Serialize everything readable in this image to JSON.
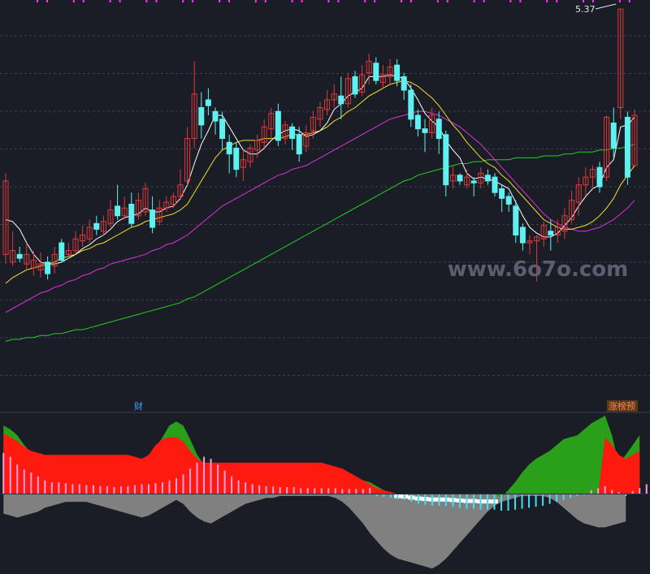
{
  "colors": {
    "background": "#1b1d26",
    "grid": "#3a3e52",
    "up_candle": "#e0393a",
    "down_candle": "#5ff0f0",
    "ma5": "#ffffff",
    "ma10": "#f0e020",
    "ma20": "#e030e0",
    "ma60": "#20d020",
    "ind_green": "#2aa01a",
    "ind_red": "#ff1a10",
    "ind_white": "#ffffff",
    "ind_gray": "#808080",
    "ind_dark": "#404040",
    "bar_pink": "#f5a0e0",
    "bar_cyan": "#40e0f0",
    "marker": "#ff30ff"
  },
  "annotations": {
    "high_price": "5.37",
    "watermark": "www.6o7o.com",
    "label_left": "财",
    "label_right": "涨榜预"
  },
  "chart_data": [
    {
      "type": "candlestick",
      "panel": "main",
      "ohlc": [
        [
          4.1,
          4.48,
          4.05,
          4.52
        ],
        [
          4.06,
          4.12,
          4.04,
          4.22
        ],
        [
          4.1,
          4.08,
          4.06,
          4.14
        ],
        [
          4.05,
          4.1,
          4.02,
          4.16
        ],
        [
          4.03,
          4.07,
          3.99,
          4.12
        ],
        [
          4.02,
          4.05,
          3.98,
          4.11
        ],
        [
          4.06,
          4.0,
          3.97,
          4.09
        ],
        [
          4.04,
          4.1,
          4.0,
          4.14
        ],
        [
          4.16,
          4.07,
          4.06,
          4.18
        ],
        [
          4.1,
          4.12,
          4.08,
          4.16
        ],
        [
          4.12,
          4.18,
          4.1,
          4.22
        ],
        [
          4.17,
          4.2,
          4.14,
          4.25
        ],
        [
          4.18,
          4.24,
          4.16,
          4.28
        ],
        [
          4.26,
          4.23,
          4.2,
          4.3
        ],
        [
          4.22,
          4.27,
          4.2,
          4.3
        ],
        [
          4.26,
          4.33,
          4.24,
          4.38
        ],
        [
          4.35,
          4.3,
          4.28,
          4.46
        ],
        [
          4.3,
          4.34,
          4.28,
          4.4
        ],
        [
          4.36,
          4.26,
          4.24,
          4.42
        ],
        [
          4.3,
          4.38,
          4.28,
          4.42
        ],
        [
          4.32,
          4.44,
          4.3,
          4.47
        ],
        [
          4.33,
          4.24,
          4.21,
          4.4
        ],
        [
          4.27,
          4.34,
          4.25,
          4.38
        ],
        [
          4.34,
          4.37,
          4.32,
          4.4
        ],
        [
          4.36,
          4.4,
          4.34,
          4.42
        ],
        [
          4.4,
          4.46,
          4.38,
          4.54
        ],
        [
          4.48,
          4.7,
          4.46,
          4.76
        ],
        [
          4.7,
          4.93,
          4.65,
          5.1
        ],
        [
          4.86,
          4.77,
          4.7,
          4.94
        ],
        [
          4.9,
          4.87,
          4.82,
          4.96
        ],
        [
          4.84,
          4.79,
          4.72,
          4.86
        ],
        [
          4.8,
          4.7,
          4.64,
          4.84
        ],
        [
          4.68,
          4.62,
          4.52,
          4.72
        ],
        [
          4.65,
          4.54,
          4.5,
          4.68
        ],
        [
          4.55,
          4.59,
          4.48,
          4.64
        ],
        [
          4.58,
          4.65,
          4.55,
          4.67
        ],
        [
          4.64,
          4.69,
          4.6,
          4.72
        ],
        [
          4.68,
          4.76,
          4.65,
          4.8
        ],
        [
          4.75,
          4.83,
          4.7,
          4.86
        ],
        [
          4.84,
          4.69,
          4.66,
          4.88
        ],
        [
          4.7,
          4.77,
          4.67,
          4.79
        ],
        [
          4.76,
          4.7,
          4.64,
          4.78
        ],
        [
          4.72,
          4.62,
          4.58,
          4.76
        ],
        [
          4.66,
          4.73,
          4.63,
          4.77
        ],
        [
          4.74,
          4.81,
          4.7,
          4.84
        ],
        [
          4.8,
          4.86,
          4.76,
          4.89
        ],
        [
          4.85,
          4.9,
          4.82,
          4.95
        ],
        [
          4.9,
          4.93,
          4.86,
          4.98
        ],
        [
          4.92,
          4.88,
          4.8,
          5.02
        ],
        [
          4.88,
          5.01,
          4.86,
          5.04
        ],
        [
          5.02,
          4.93,
          4.91,
          5.05
        ],
        [
          4.94,
          5.03,
          4.92,
          5.08
        ],
        [
          5.04,
          5.1,
          4.98,
          5.14
        ],
        [
          5.09,
          5.0,
          4.98,
          5.12
        ],
        [
          4.99,
          5.03,
          4.96,
          5.08
        ],
        [
          5.02,
          5.07,
          4.98,
          5.11
        ],
        [
          5.08,
          5.0,
          4.97,
          5.11
        ],
        [
          5.02,
          4.95,
          4.9,
          5.04
        ],
        [
          4.95,
          4.8,
          4.76,
          4.98
        ],
        [
          4.82,
          4.75,
          4.71,
          4.85
        ],
        [
          4.75,
          4.73,
          4.63,
          4.8
        ],
        [
          4.73,
          4.82,
          4.7,
          4.86
        ],
        [
          4.8,
          4.7,
          4.62,
          4.84
        ],
        [
          4.72,
          4.46,
          4.4,
          4.74
        ],
        [
          4.48,
          4.51,
          4.44,
          4.56
        ],
        [
          4.51,
          4.48,
          4.46,
          4.52
        ],
        [
          4.46,
          4.5,
          4.44,
          4.54
        ],
        [
          4.48,
          4.47,
          4.4,
          4.5
        ],
        [
          4.47,
          4.52,
          4.44,
          4.55
        ],
        [
          4.51,
          4.48,
          4.46,
          4.54
        ],
        [
          4.5,
          4.42,
          4.4,
          4.52
        ],
        [
          4.44,
          4.39,
          4.32,
          4.46
        ],
        [
          4.4,
          4.36,
          4.32,
          4.42
        ],
        [
          4.35,
          4.2,
          4.16,
          4.38
        ],
        [
          4.24,
          4.16,
          4.12,
          4.26
        ],
        [
          4.16,
          4.17,
          4.1,
          4.2
        ],
        [
          4.17,
          4.19,
          3.96,
          4.2
        ],
        [
          4.18,
          4.25,
          4.14,
          4.27
        ],
        [
          4.22,
          4.2,
          4.12,
          4.28
        ],
        [
          4.2,
          4.24,
          4.16,
          4.28
        ],
        [
          4.22,
          4.3,
          4.18,
          4.34
        ],
        [
          4.28,
          4.38,
          4.26,
          4.43
        ],
        [
          4.37,
          4.46,
          4.3,
          4.5
        ],
        [
          4.46,
          4.5,
          4.4,
          4.55
        ],
        [
          4.5,
          4.54,
          4.44,
          4.56
        ],
        [
          4.55,
          4.45,
          4.42,
          4.58
        ],
        [
          4.5,
          4.81,
          4.48,
          4.82
        ],
        [
          4.78,
          4.65,
          4.6,
          4.86
        ],
        [
          4.86,
          5.37,
          4.8,
          5.37
        ],
        [
          4.81,
          4.5,
          4.46,
          4.84
        ],
        [
          4.56,
          4.82,
          4.55,
          4.85
        ]
      ],
      "ma5": [
        4.28,
        4.27,
        4.23,
        4.16,
        4.1,
        4.06,
        4.05,
        4.05,
        4.06,
        4.08,
        4.1,
        4.13,
        4.15,
        4.18,
        4.2,
        4.23,
        4.27,
        4.29,
        4.3,
        4.31,
        4.34,
        4.32,
        4.32,
        4.34,
        4.35,
        4.39,
        4.46,
        4.57,
        4.67,
        4.74,
        4.82,
        4.82,
        4.76,
        4.7,
        4.64,
        4.62,
        4.62,
        4.65,
        4.69,
        4.72,
        4.74,
        4.75,
        4.74,
        4.71,
        4.72,
        4.74,
        4.78,
        4.85,
        4.88,
        4.92,
        4.94,
        4.96,
        5.02,
        5.02,
        5.02,
        5.03,
        5.02,
        5.01,
        4.96,
        4.9,
        4.83,
        4.79,
        4.76,
        4.69,
        4.64,
        4.6,
        4.52,
        4.49,
        4.5,
        4.49,
        4.48,
        4.46,
        4.44,
        4.37,
        4.3,
        4.24,
        4.21,
        4.19,
        4.19,
        4.21,
        4.25,
        4.29,
        4.35,
        4.4,
        4.44,
        4.46,
        4.55,
        4.59,
        4.76,
        4.77,
        4.81
      ],
      "ma10": [
        3.95,
        3.98,
        4.0,
        4.02,
        4.03,
        4.04,
        4.05,
        4.06,
        4.08,
        4.09,
        4.1,
        4.12,
        4.13,
        4.15,
        4.16,
        4.18,
        4.2,
        4.22,
        4.24,
        4.25,
        4.27,
        4.28,
        4.29,
        4.3,
        4.31,
        4.33,
        4.36,
        4.42,
        4.48,
        4.54,
        4.6,
        4.64,
        4.66,
        4.68,
        4.69,
        4.69,
        4.69,
        4.7,
        4.7,
        4.7,
        4.71,
        4.72,
        4.72,
        4.72,
        4.73,
        4.74,
        4.76,
        4.79,
        4.81,
        4.84,
        4.86,
        4.89,
        4.92,
        4.94,
        4.96,
        4.98,
        4.99,
        5.0,
        4.99,
        4.97,
        4.94,
        4.91,
        4.87,
        4.82,
        4.77,
        4.73,
        4.68,
        4.64,
        4.6,
        4.57,
        4.55,
        4.51,
        4.48,
        4.44,
        4.4,
        4.36,
        4.32,
        4.28,
        4.26,
        4.24,
        4.23,
        4.23,
        4.24,
        4.25,
        4.27,
        4.3,
        4.34,
        4.39,
        4.46,
        4.51,
        4.56
      ],
      "ma20": [
        3.8,
        3.82,
        3.84,
        3.86,
        3.88,
        3.9,
        3.91,
        3.93,
        3.94,
        3.96,
        3.97,
        3.99,
        4.0,
        4.02,
        4.03,
        4.05,
        4.06,
        4.07,
        4.08,
        4.09,
        4.1,
        4.12,
        4.13,
        4.15,
        4.16,
        4.18,
        4.2,
        4.23,
        4.26,
        4.29,
        4.32,
        4.35,
        4.37,
        4.39,
        4.41,
        4.43,
        4.45,
        4.47,
        4.49,
        4.51,
        4.52,
        4.54,
        4.55,
        4.56,
        4.58,
        4.6,
        4.62,
        4.64,
        4.66,
        4.68,
        4.7,
        4.72,
        4.74,
        4.76,
        4.78,
        4.8,
        4.81,
        4.82,
        4.83,
        4.84,
        4.84,
        4.83,
        4.82,
        4.8,
        4.78,
        4.76,
        4.73,
        4.7,
        4.67,
        4.63,
        4.59,
        4.55,
        4.51,
        4.47,
        4.43,
        4.39,
        4.35,
        4.31,
        4.28,
        4.26,
        4.24,
        4.23,
        4.22,
        4.22,
        4.23,
        4.24,
        4.26,
        4.28,
        4.31,
        4.34,
        4.38
      ],
      "ma60": [
        3.65,
        3.66,
        3.66,
        3.67,
        3.67,
        3.68,
        3.68,
        3.69,
        3.69,
        3.7,
        3.71,
        3.71,
        3.72,
        3.73,
        3.74,
        3.75,
        3.76,
        3.77,
        3.78,
        3.79,
        3.8,
        3.81,
        3.82,
        3.83,
        3.84,
        3.85,
        3.87,
        3.88,
        3.9,
        3.92,
        3.94,
        3.96,
        3.98,
        4.0,
        4.02,
        4.04,
        4.06,
        4.08,
        4.1,
        4.12,
        4.14,
        4.16,
        4.18,
        4.2,
        4.22,
        4.24,
        4.26,
        4.28,
        4.3,
        4.32,
        4.34,
        4.36,
        4.38,
        4.4,
        4.42,
        4.44,
        4.46,
        4.48,
        4.49,
        4.51,
        4.52,
        4.53,
        4.54,
        4.55,
        4.56,
        4.57,
        4.57,
        4.58,
        4.58,
        4.59,
        4.59,
        4.59,
        4.59,
        4.6,
        4.6,
        4.6,
        4.6,
        4.61,
        4.61,
        4.61,
        4.62,
        4.62,
        4.63,
        4.63,
        4.63,
        4.64,
        4.64,
        4.65,
        4.65,
        4.66,
        4.67
      ],
      "ylim": [
        3.45,
        5.4
      ]
    },
    {
      "type": "area",
      "panel": "indicator",
      "ylim": [
        -80,
        80
      ],
      "bars": [
        42,
        38,
        30,
        25,
        22,
        18,
        14,
        12,
        12,
        11,
        10,
        10,
        9,
        9,
        8,
        8,
        7,
        8,
        8,
        9,
        10,
        10,
        11,
        12,
        14,
        16,
        20,
        26,
        32,
        38,
        36,
        30,
        24,
        18,
        14,
        12,
        10,
        9,
        8,
        8,
        7,
        7,
        7,
        6,
        6,
        6,
        6,
        6,
        6,
        5,
        5,
        5,
        5,
        6,
        -2,
        -3,
        -4,
        -5,
        -6,
        -8,
        -10,
        -11,
        -12,
        -12,
        -12,
        -13,
        -14,
        -15,
        -15,
        -16,
        -16,
        -16,
        -17,
        -17,
        -16,
        -15,
        -14,
        -13,
        -12,
        -10,
        -8,
        -6,
        -4,
        -2,
        -1,
        4,
        6,
        8,
        4,
        2,
        -2,
        3,
        6,
        10
      ],
      "green_top": [
        70,
        66,
        60,
        50,
        42,
        38,
        36,
        36,
        36,
        36,
        36,
        36,
        35,
        35,
        34,
        34,
        34,
        34,
        34,
        34,
        35,
        38,
        46,
        58,
        70,
        74,
        70,
        56,
        40,
        30,
        28,
        28,
        26,
        24,
        22,
        22,
        22,
        22,
        24,
        24,
        26,
        26,
        26,
        26,
        26,
        26,
        26,
        26,
        24,
        22,
        18,
        16,
        14,
        12,
        8,
        4,
        0,
        0,
        0,
        0,
        0,
        0,
        0,
        0,
        0,
        0,
        0,
        0,
        0,
        0,
        0,
        0,
        -4,
        4,
        12,
        22,
        30,
        36,
        40,
        44,
        50,
        56,
        58,
        60,
        66,
        72,
        76,
        80,
        60,
        30,
        40,
        50,
        60
      ],
      "red_top": [
        62,
        58,
        54,
        48,
        44,
        42,
        40,
        40,
        40,
        40,
        40,
        40,
        40,
        40,
        40,
        40,
        40,
        40,
        40,
        38,
        36,
        40,
        50,
        56,
        58,
        58,
        54,
        44,
        36,
        32,
        32,
        32,
        32,
        32,
        32,
        32,
        32,
        32,
        32,
        32,
        32,
        32,
        32,
        32,
        32,
        32,
        32,
        30,
        28,
        26,
        22,
        18,
        14,
        10,
        6,
        4,
        2,
        0,
        0,
        0,
        0,
        0,
        0,
        0,
        0,
        0,
        0,
        0,
        0,
        0,
        0,
        0,
        0,
        0,
        0,
        0,
        0,
        0,
        0,
        0,
        0,
        0,
        0,
        0,
        0,
        0,
        0,
        58,
        50,
        40,
        36,
        40,
        44
      ],
      "gray_bottom": [
        -20,
        -22,
        -24,
        -22,
        -20,
        -18,
        -14,
        -12,
        -10,
        -8,
        -8,
        -8,
        -8,
        -10,
        -12,
        -14,
        -16,
        -18,
        -20,
        -22,
        -24,
        -22,
        -18,
        -14,
        -10,
        -6,
        -10,
        -18,
        -24,
        -28,
        -30,
        -26,
        -22,
        -18,
        -14,
        -10,
        -8,
        -6,
        -4,
        -4,
        -2,
        -2,
        -2,
        -2,
        -2,
        -2,
        -2,
        -2,
        -4,
        -8,
        -14,
        -22,
        -30,
        -40,
        -48,
        -56,
        -62,
        -66,
        -68,
        -70,
        -72,
        -74,
        -76,
        -72,
        -66,
        -58,
        -50,
        -42,
        -34,
        -26,
        -18,
        -12,
        -8,
        -6,
        -4,
        -2,
        -2,
        -2,
        -2,
        -4,
        -8,
        -14,
        -20,
        -26,
        -30,
        -32,
        -34,
        -34,
        -32,
        -30,
        -28
      ]
    }
  ]
}
